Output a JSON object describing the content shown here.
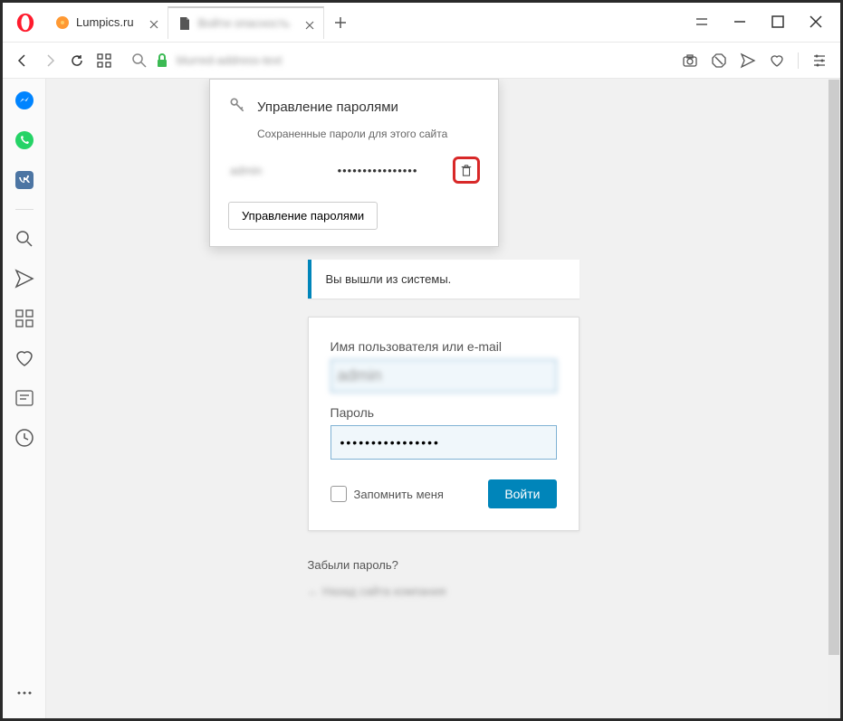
{
  "tabs": {
    "tab1_label": "Lumpics.ru",
    "tab2_label": "Войти опасность"
  },
  "popup": {
    "title": "Управление паролями",
    "subtitle": "Сохраненные пароли для этого сайта",
    "username": "admin",
    "password_dots": "••••••••••••••••",
    "manage_button": "Управление паролями"
  },
  "login": {
    "alert": "Вы вышли из системы.",
    "username_label": "Имя пользователя или e-mail",
    "username_value": "admin",
    "password_label": "Пароль",
    "password_dots": "••••••••••••••••",
    "remember_label": "Запомнить меня",
    "submit_label": "Войти",
    "forgot_label": "Забыли пароль?",
    "back_label": "← Назад сайта компания"
  },
  "addr": {
    "text": "blurred-address-text"
  }
}
